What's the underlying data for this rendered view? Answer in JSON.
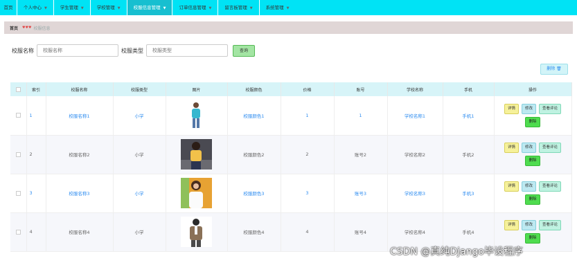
{
  "nav": {
    "home": "首页",
    "menus": [
      {
        "label": "个人中心",
        "active": false
      },
      {
        "label": "学生管理",
        "active": false
      },
      {
        "label": "学校管理",
        "active": false
      },
      {
        "label": "校服信息管理",
        "active": true
      },
      {
        "label": "订单信息管理",
        "active": false
      },
      {
        "label": "留言板管理",
        "active": false
      },
      {
        "label": "系统管理",
        "active": false
      }
    ]
  },
  "breadcrumb": {
    "home": "首页",
    "current": "校服信息"
  },
  "search": {
    "name_label": "校服名称",
    "name_placeholder": "校服名称",
    "type_label": "校服类型",
    "type_placeholder": "校服类型",
    "query_button": "查询"
  },
  "toolbar": {
    "delete_label": "删除"
  },
  "table": {
    "columns": [
      "索引",
      "校服名称",
      "校服类型",
      "图片",
      "校服颜色",
      "价格",
      "账号",
      "学校名称",
      "手机",
      "操作"
    ],
    "actions": {
      "detail": "详情",
      "edit": "修改",
      "review": "查看评论",
      "delete": "删除"
    },
    "rows": [
      {
        "index": "1",
        "name": "校服名称1",
        "type": "小学",
        "color": "校服颜色1",
        "price": "1",
        "account": "1",
        "school": "学校名称1",
        "phone": "手机1"
      },
      {
        "index": "2",
        "name": "校服名称2",
        "type": "小学",
        "color": "校服颜色2",
        "price": "2",
        "account": "账号2",
        "school": "学校名称2",
        "phone": "手机2"
      },
      {
        "index": "3",
        "name": "校服名称3",
        "type": "小学",
        "color": "校服颜色3",
        "price": "3",
        "account": "账号3",
        "school": "学校名称3",
        "phone": "手机3"
      },
      {
        "index": "4",
        "name": "校服名称4",
        "type": "小学",
        "color": "校服颜色4",
        "price": "4",
        "account": "账号4",
        "school": "学校名称4",
        "phone": "手机4"
      }
    ]
  },
  "watermark": "CSDN @真纯Django毕设程序",
  "colors": {
    "nav_bg": "#00e3f5",
    "nav_active": "#17bfd0",
    "link": "#2d8cf0",
    "delete_green": "#4fdc4f"
  }
}
